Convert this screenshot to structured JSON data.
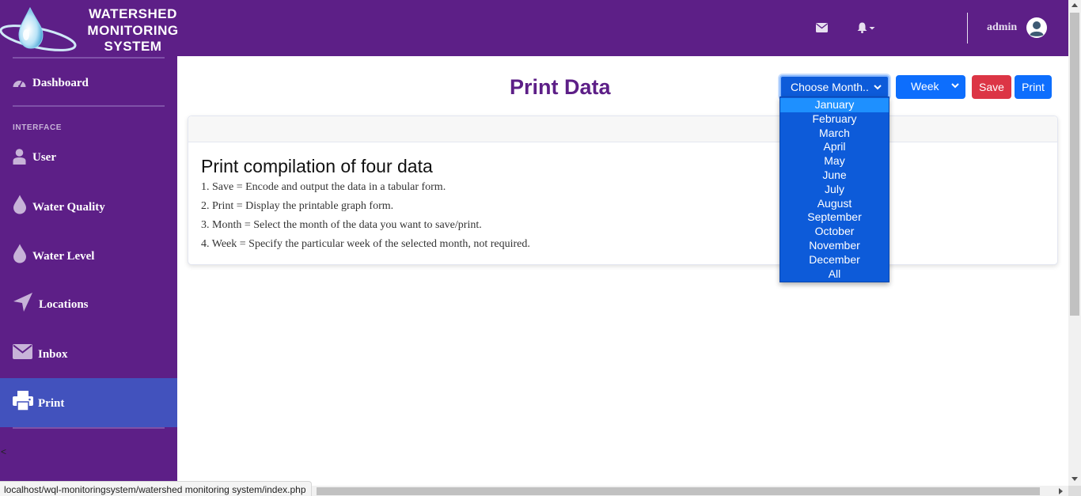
{
  "brand": {
    "lines": [
      "WATERSHED",
      "MONITORING",
      "SYSTEM"
    ]
  },
  "header": {
    "user_name": "admin",
    "icons": [
      "envelope-icon",
      "bell-icon",
      "user-avatar-icon"
    ]
  },
  "sidebar": {
    "heading": "INTERFACE",
    "toggle": "<",
    "items": [
      {
        "label": "Dashboard",
        "icon": "tachometer-icon"
      },
      {
        "label": "User",
        "icon": "user-icon"
      },
      {
        "label": "Water Quality",
        "icon": "droplet-icon"
      },
      {
        "label": "Water Level",
        "icon": "droplet-icon"
      },
      {
        "label": "Locations",
        "icon": "location-arrow-icon"
      },
      {
        "label": "Inbox",
        "icon": "envelope-icon"
      },
      {
        "label": "Print",
        "icon": "printer-icon",
        "active": true
      }
    ]
  },
  "main": {
    "title": "Print Data",
    "month_select": {
      "value": "Choose Month.."
    },
    "week_select": {
      "value": "Week"
    },
    "save_label": "Save",
    "print_label": "Print",
    "card": {
      "title": "Print compilation of four data",
      "lines": [
        "1. Save = Encode and output the data in a tabular form.",
        "2. Print = Display the printable graph form.",
        "3. Month = Select the month of the data you want to save/print.",
        "4. Week = Specify the particular week of the selected month, not required."
      ]
    }
  },
  "month_dropdown": {
    "highlighted": "January",
    "options": [
      "January",
      "February",
      "March",
      "April",
      "May",
      "June",
      "July",
      "August",
      "September",
      "October",
      "November",
      "December",
      "All"
    ]
  },
  "statusbar": {
    "url": "localhost/wql-monitoringsystem/watershed monitoring system/index.php"
  },
  "colors": {
    "primary_purple": "#5d1f87",
    "active_item": "#4252bd",
    "blue_button": "#0d6efd",
    "red_button": "#dc3545"
  }
}
